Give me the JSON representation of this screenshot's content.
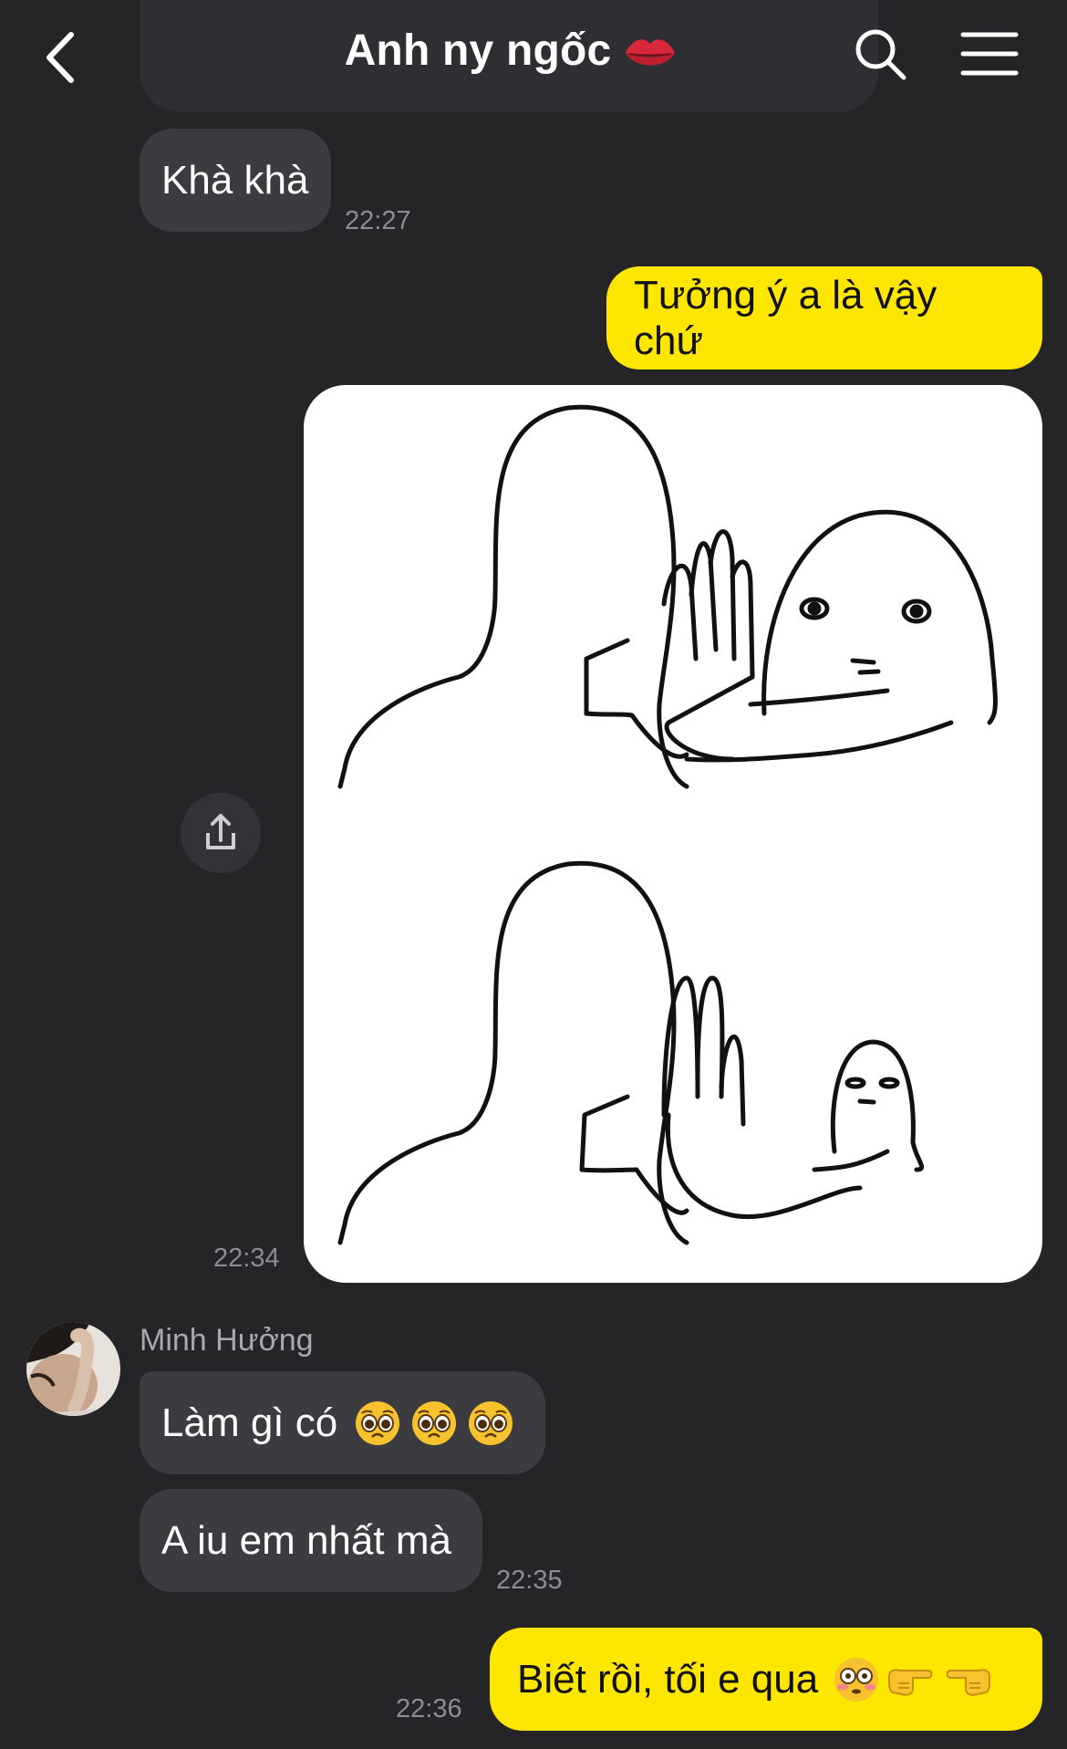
{
  "header": {
    "title": "Anh ny ngốc"
  },
  "messages": {
    "m1": {
      "text": "Khà khà",
      "time": "22:27"
    },
    "m2": {
      "text": "Tưởng ý a là vậy chứ"
    },
    "m3": {
      "time": "22:34"
    },
    "m4": {
      "sender": "Minh Hưởng",
      "text": "Làm gì có"
    },
    "m5": {
      "text": "A iu em nhất mà",
      "time": "22:35"
    },
    "m6": {
      "text": "Biết rồi, tối e qua",
      "time": "22:36"
    }
  },
  "colors": {
    "background": "#252528",
    "incoming_bubble": "#3b3b40",
    "outgoing_bubble": "#fde600"
  },
  "icons": [
    "back-chevron-icon",
    "lips-icon",
    "search-icon",
    "menu-icon",
    "share-icon",
    "pleading-face-icon",
    "flushed-face-icon",
    "pointing-right-icon",
    "pointing-left-icon"
  ]
}
